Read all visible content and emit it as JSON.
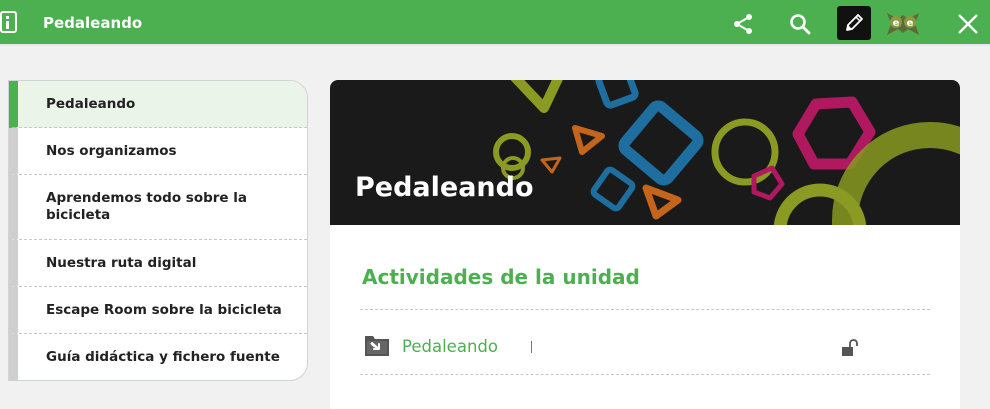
{
  "header": {
    "title": "Pedaleando",
    "icons": [
      "menu-book-icon",
      "share-icon",
      "search-icon",
      "edit-pencil-icon",
      "exe-logo-icon",
      "close-icon"
    ],
    "bg_color": "#4caf50"
  },
  "sidebar": {
    "items": [
      {
        "label": "Pedaleando",
        "active": true
      },
      {
        "label": "Nos organizamos",
        "active": false
      },
      {
        "label": "Aprendemos todo sobre la bicicleta",
        "active": false
      },
      {
        "label": "Nuestra ruta digital",
        "active": false
      },
      {
        "label": "Escape Room sobre la bicicleta",
        "active": false
      },
      {
        "label": "Guía didáctica y fichero fuente",
        "active": false
      }
    ],
    "active_color": "#4caf50"
  },
  "main": {
    "hero_title": "Pedaleando",
    "section_title": "Actividades de la unidad",
    "activities": [
      {
        "label": "Pedaleando",
        "icon": "folder-arrow-icon",
        "status_icon": "unlock-icon"
      }
    ]
  }
}
